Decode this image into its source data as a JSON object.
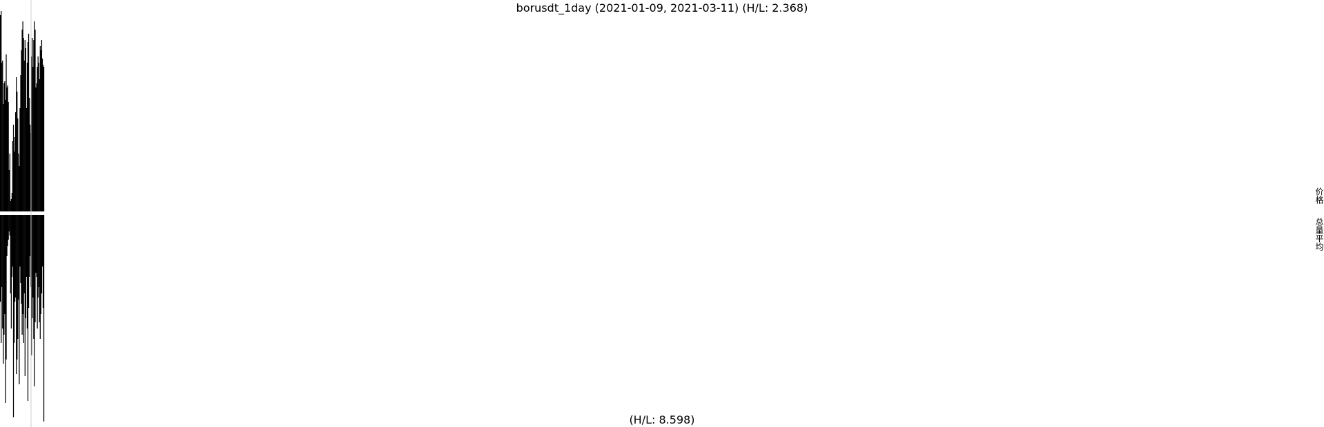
{
  "chart_data": {
    "type": "bar",
    "title": "borusdt_1day (2021-01-09, 2021-03-11) (H/L: 2.368)",
    "subtitle": "(H/L: 8.598)",
    "right_labels": [
      "价格",
      "总量平均"
    ],
    "colors": {
      "bars": "#000000",
      "cursor": "#cccccc",
      "background": "#ffffff"
    },
    "price_panel": {
      "ylim": [
        0,
        1
      ],
      "values": [
        0.95,
        0.97,
        0.72,
        0.73,
        0.52,
        0.62,
        0.63,
        0.54,
        0.76,
        0.6,
        0.61,
        0.53,
        0.2,
        0.28,
        0.05,
        0.06,
        0.09,
        0.34,
        0.42,
        0.29,
        0.36,
        0.48,
        0.65,
        0.58,
        0.45,
        0.28,
        0.22,
        0.5,
        0.66,
        0.78,
        0.88,
        0.92,
        0.84,
        0.73,
        0.83,
        0.79,
        0.5,
        0.72,
        0.82,
        0.86,
        0.55,
        0.42,
        0.38,
        0.75,
        0.84,
        0.7,
        0.83,
        0.92,
        0.88,
        0.6,
        0.62,
        0.7,
        0.75,
        0.72,
        0.64,
        0.8,
        0.78,
        0.83,
        0.74,
        0.71,
        0.7
      ]
    },
    "volume_panel": {
      "ylim": [
        0,
        1
      ],
      "values": [
        0.42,
        0.62,
        0.35,
        0.55,
        0.72,
        0.58,
        0.48,
        0.91,
        0.7,
        0.2,
        0.15,
        0.12,
        0.08,
        0.1,
        0.38,
        0.55,
        0.3,
        0.25,
        0.98,
        0.62,
        0.42,
        0.4,
        0.77,
        0.7,
        0.6,
        0.41,
        0.82,
        0.25,
        0.33,
        0.43,
        0.58,
        0.48,
        0.62,
        0.38,
        0.78,
        0.5,
        0.3,
        0.55,
        0.9,
        0.45,
        0.3,
        0.2,
        0.35,
        0.68,
        0.5,
        0.4,
        0.6,
        0.83,
        0.52,
        0.28,
        0.3,
        0.55,
        0.4,
        0.35,
        0.52,
        0.6,
        0.48,
        0.38,
        0.25,
        0.45,
        1.0
      ]
    }
  }
}
